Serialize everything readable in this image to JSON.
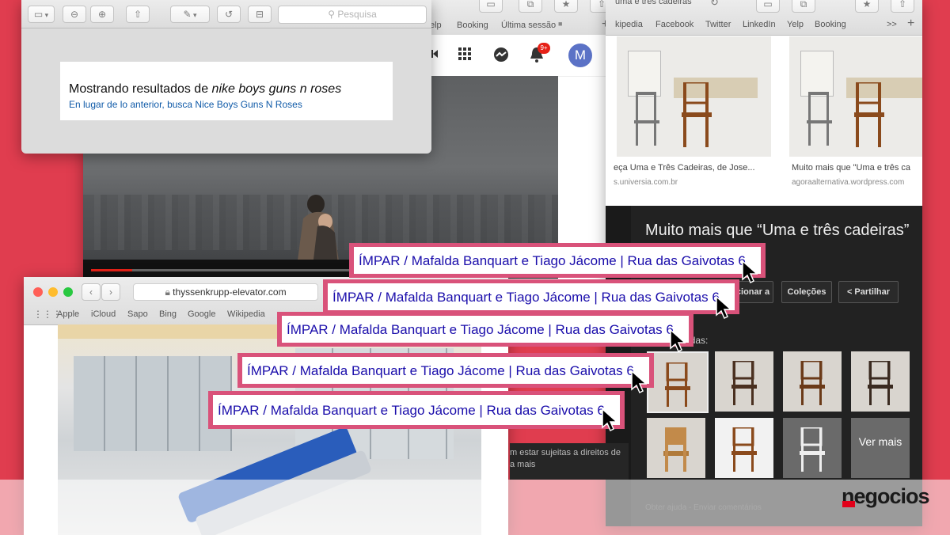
{
  "preview_window": {
    "search_placeholder": "Pesquisa",
    "results_prefix": "Mostrando resultados de ",
    "results_query": "nike boys guns n roses",
    "alternative_text": "En lugar de lo anterior, busca Nice Boys Guns N Roses"
  },
  "youtube_window": {
    "bookmarks": [
      "elp",
      "Booking",
      "Última sessão"
    ],
    "notification_count": "9+",
    "avatar_letter": "M",
    "video_progress": 0.09
  },
  "images_window": {
    "tab_title": "uma e três cadeiras",
    "bookmarks": [
      "kipedia",
      "Facebook",
      "Twitter",
      "LinkedIn",
      "Yelp",
      "Booking",
      ">>"
    ],
    "results": [
      {
        "title": "eça Uma e Três Cadeiras, de Jose...",
        "url": "s.universia.com.br"
      },
      {
        "title": "Muito mais que \"Uma e três ca",
        "url": "agoraalternativa.wordpress.com"
      }
    ],
    "panel_title": "Muito mais que “Uma e três cadeiras”",
    "buttons": [
      "cionar a",
      "Coleções",
      "Partilhar"
    ],
    "related_label": "elacionadas:",
    "see_more": "Ver mais",
    "rights_line1": "m estar sujeitas a direitos de",
    "rights_line2": "a mais",
    "footer_help": "Obter ajuda",
    "footer_feedback": "Enviar comentários",
    "footer_sep": "-"
  },
  "thyssen_window": {
    "url": "thyssenkrupp-elevator.com",
    "bookmarks": [
      "Apple",
      "iCloud",
      "Sapo",
      "Bing",
      "Google",
      "Wikipedia"
    ]
  },
  "search_results": [
    "ÍMPAR / Mafalda Banquart e Tiago Jácome | Rua das Gaivotas 6",
    "ÍMPAR / Mafalda Banquart e Tiago Jácome | Rua das Gaivotas 6",
    "ÍMPAR / Mafalda Banquart e Tiago Jácome | Rua das Gaivotas 6",
    "ÍMPAR / Mafalda Banquart e Tiago Jácome | Rua das Gaivotas 6",
    "ÍMPAR / Mafalda Banquart e Tiago Jácome | Rua das Gaivotas 6"
  ],
  "brand": "negocios",
  "colors": {
    "background": "#e03d4f",
    "highlight": "#d9527a",
    "link": "#1a0dab",
    "youtube_red": "#e62117",
    "brand_red": "#e2001a"
  },
  "icons": [
    "sidebar-icon",
    "zoom-out-icon",
    "zoom-in-icon",
    "share-icon",
    "pen-icon",
    "rotate-icon",
    "toolbox-icon",
    "search-icon",
    "camera-icon",
    "apps-grid-icon",
    "messenger-icon",
    "bell-icon",
    "reload-icon",
    "lock-icon",
    "cursor-arrow-icon"
  ]
}
